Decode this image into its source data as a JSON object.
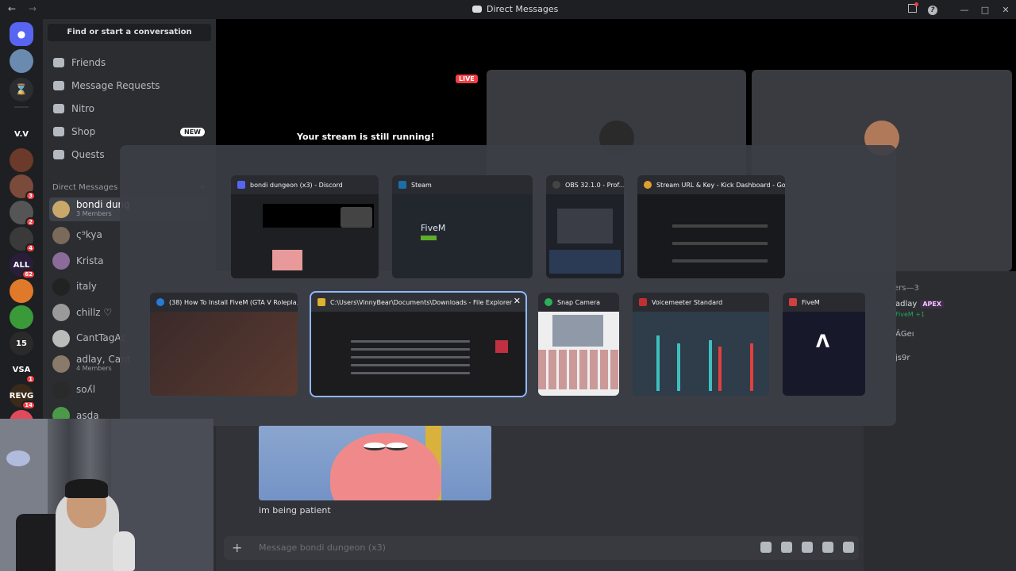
{
  "titlebar": {
    "title": "Direct Messages"
  },
  "rail": {
    "servers": [
      {
        "label": "V.V",
        "badge": "",
        "color": "#1e1f22"
      },
      {
        "label": "",
        "badge": "",
        "color": "#6b3a2a"
      },
      {
        "label": "",
        "badge": "3",
        "color": "#7a4a3a"
      },
      {
        "label": "",
        "badge": "2",
        "color": "#555"
      },
      {
        "label": "",
        "badge": "4",
        "color": "#3a3a3a"
      },
      {
        "label": "ALL",
        "badge": "62",
        "color": "#2a1d3a"
      },
      {
        "label": "",
        "badge": "",
        "color": "#e07a2a"
      },
      {
        "label": "",
        "badge": "",
        "color": "#3a9a3a"
      },
      {
        "label": "15",
        "badge": "",
        "color": "#2a2a2a"
      },
      {
        "label": "VSA",
        "badge": "1",
        "color": "#1e1f22"
      },
      {
        "label": "REVG",
        "badge": "14",
        "color": "#3a2a1a"
      },
      {
        "label": "",
        "badge": "1",
        "color": "#e04a5a"
      }
    ]
  },
  "sidebar": {
    "search_label": "Find or start a conversation",
    "nav": [
      {
        "label": "Friends",
        "badge": ""
      },
      {
        "label": "Message Requests",
        "badge": ""
      },
      {
        "label": "Nitro",
        "badge": ""
      },
      {
        "label": "Shop",
        "badge": "NEW"
      },
      {
        "label": "Quests",
        "badge": ""
      }
    ],
    "dm_header": "Direct Messages",
    "dms": [
      {
        "name": "bondi dung",
        "sub": "3 Members",
        "color": "#c9a86a",
        "active": true
      },
      {
        "name": "ς⁹kya",
        "sub": "",
        "color": "#7b6a5a",
        "active": false
      },
      {
        "name": "Krista",
        "sub": "",
        "color": "#8a6b9a",
        "active": false
      },
      {
        "name": "italy",
        "sub": "",
        "color": "#222",
        "active": false
      },
      {
        "name": "chillz ♡",
        "sub": "",
        "color": "#9a9a9a",
        "active": false
      },
      {
        "name": "CantTagAc",
        "sub": "",
        "color": "#bbb",
        "active": false
      },
      {
        "name": "adlay, Cant",
        "sub": "4 Members",
        "color": "#8a7a6a",
        "active": false
      },
      {
        "name": "soʎl",
        "sub": "",
        "color": "#2a2a2a",
        "active": false
      },
      {
        "name": "asda",
        "sub": "",
        "color": "#4a9a4a",
        "active": false
      }
    ]
  },
  "stream": {
    "live_label": "LIVE",
    "running_text": "Your stream is still running!"
  },
  "members": {
    "header": "ers—3",
    "items": [
      "adlay",
      "FiveM +1",
      "ÁǤeı",
      "js9r"
    ],
    "apex_tag": "APEX"
  },
  "chat": {
    "message_text": "im being patient",
    "composer_placeholder": "Message bondi dungeon (x3)"
  },
  "alttab": {
    "windows": [
      {
        "title": "bondi dungeon (x3) - Discord",
        "icon_color": "#5865f2"
      },
      {
        "title": "Steam",
        "icon_color": "#1b6ea8",
        "thumb_text": "FiveM"
      },
      {
        "title": "OBS 32.1.0 - Prof...",
        "icon_color": "#444"
      },
      {
        "title": "Stream URL & Key - Kick Dashboard - Go...",
        "icon_color": "#e0a030"
      },
      {
        "title": "(38) How To Install FiveM (GTA V Roleplа...",
        "icon_color": "#2a7ad8"
      },
      {
        "title": "C:\\Users\\VinnyBear\\Documents\\Downloads - File Explorer",
        "icon_color": "#e0b030"
      },
      {
        "title": "Snap Camera",
        "icon_color": "#2ab05a"
      },
      {
        "title": "Voicemeeter Standard",
        "icon_color": "#c03030"
      },
      {
        "title": "FiveM",
        "icon_color": "#d04040"
      }
    ]
  }
}
